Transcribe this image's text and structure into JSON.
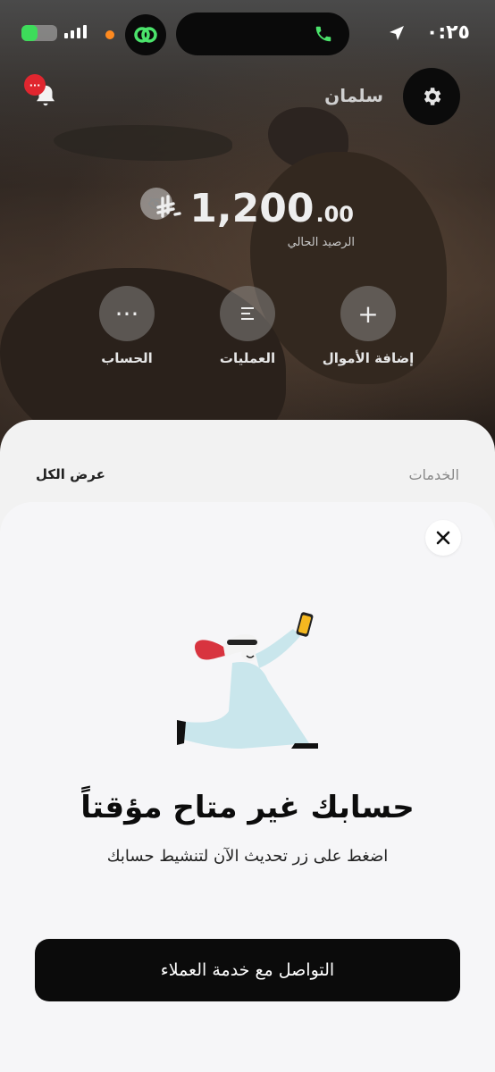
{
  "status_bar": {
    "time": "٠:٢٥",
    "battery_level": 0.45,
    "icons": [
      "battery-charging-icon",
      "signal-icon",
      "recording-dot-icon",
      "app-link-icon",
      "phone-call-icon",
      "location-arrow-icon"
    ]
  },
  "header": {
    "username": "سلمان",
    "notification_badge": "···",
    "icons": [
      "settings-gear-icon",
      "bell-icon"
    ]
  },
  "balance": {
    "currency_symbol": "⃁",
    "amount_int": "1,200",
    "amount_dec": ".00",
    "label": "الرصيد الحالي"
  },
  "actions": [
    {
      "label": "إضافة الأموال",
      "icon": "plus-icon",
      "glyph": "+"
    },
    {
      "label": "العمليات",
      "icon": "transactions-list-icon",
      "glyph": "☰"
    },
    {
      "label": "الحساب",
      "icon": "more-dots-icon",
      "glyph": "···"
    }
  ],
  "services": {
    "title": "الخدمات",
    "view_all": "عرض الكل"
  },
  "modal": {
    "title": "حسابك غير متاح مؤقتاً",
    "subtitle": "اضغط على زر تحديث الآن لتنشيط حسابك",
    "cta_label": "التواصل مع خدمة العملاء",
    "illustration": "man-taking-selfie-illustration"
  },
  "colors": {
    "badge_red": "#e0262f",
    "modal_bg": "#f6f6f8",
    "cta_bg": "#0b0b0b",
    "app_green": "#4be36b"
  }
}
